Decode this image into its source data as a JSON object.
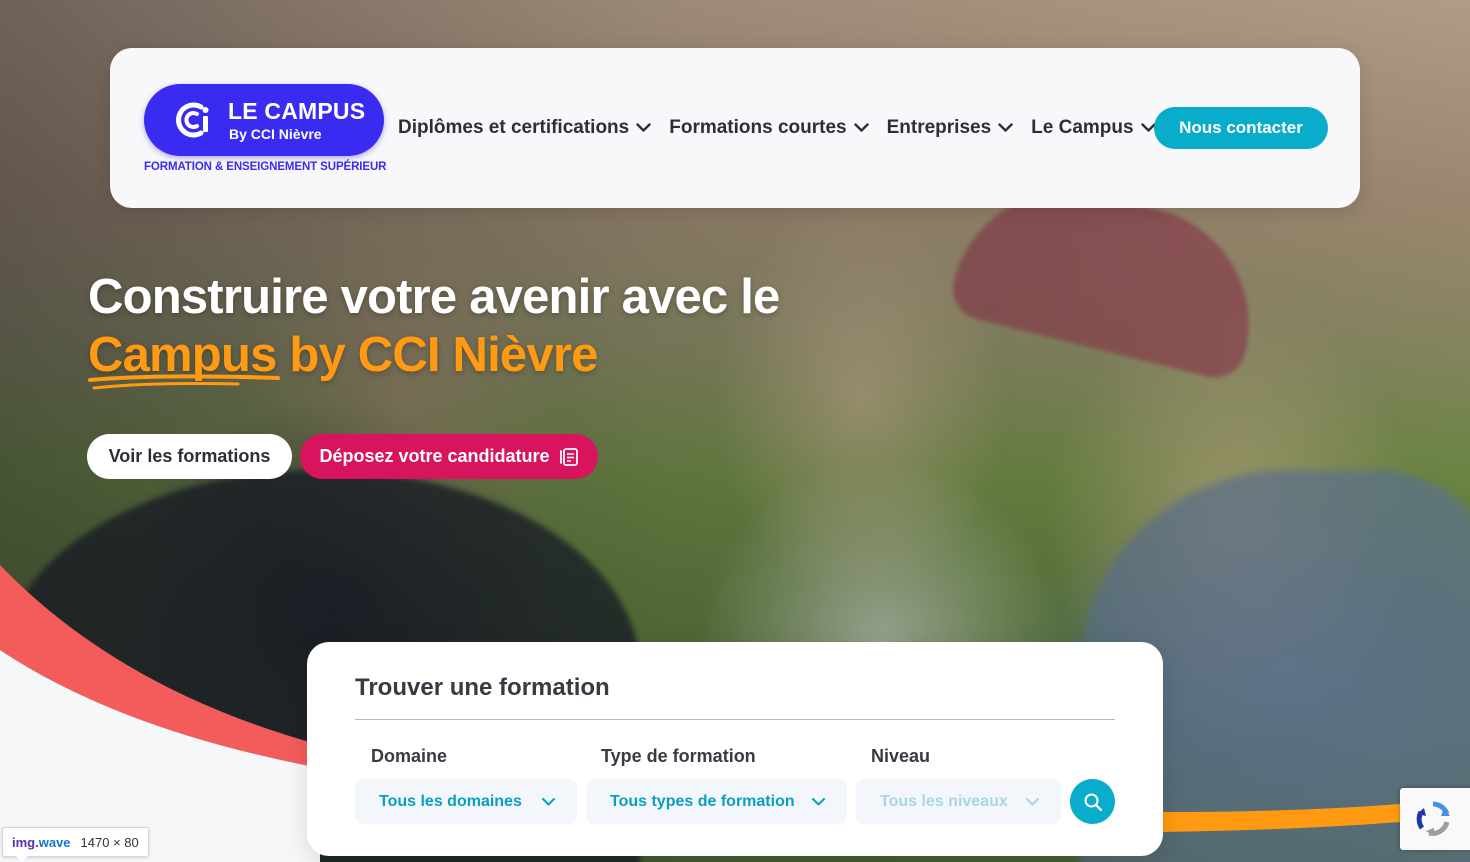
{
  "colors": {
    "brand_blue": "#3a2bf0",
    "accent_orange": "#ff9a12",
    "cta_pink": "#d8145e",
    "cta_teal": "#0aaccc",
    "coral_curve": "#f45c5c"
  },
  "logo": {
    "title": "LE CAMPUS",
    "subtitle": "By CCI Nièvre",
    "tagline": "FORMATION & ENSEIGNEMENT SUPÉRIEUR",
    "icon": "cci-logo-icon"
  },
  "nav": {
    "items": [
      {
        "label": "Diplômes et certifications",
        "icon": "chevron-down-icon"
      },
      {
        "label": "Formations courtes",
        "icon": "chevron-down-icon"
      },
      {
        "label": "Entreprises",
        "icon": "chevron-down-icon"
      },
      {
        "label": "Le Campus",
        "icon": "chevron-down-icon"
      }
    ],
    "contact_label": "Nous contacter"
  },
  "hero": {
    "headline_main": "Construire votre avenir avec le",
    "headline_accent": "Campus by CCI Nièvre",
    "btn_formations": "Voir les formations",
    "btn_candidature": "Déposez votre candidature",
    "btn_candidature_icon": "form-document-icon"
  },
  "search": {
    "title": "Trouver une formation",
    "fields": [
      {
        "label": "Domaine",
        "value": "Tous les domaines",
        "enabled": true
      },
      {
        "label": "Type de formation",
        "value": "Tous types de formation",
        "enabled": true
      },
      {
        "label": "Niveau",
        "value": "Tous les niveaux",
        "enabled": false
      }
    ],
    "button_icon": "search-icon"
  },
  "overlays": {
    "imgwave_brand_a": "img.",
    "imgwave_brand_b": "wave",
    "imgwave_dims": "1470 × 80",
    "recaptcha_icon": "recaptcha-icon"
  }
}
